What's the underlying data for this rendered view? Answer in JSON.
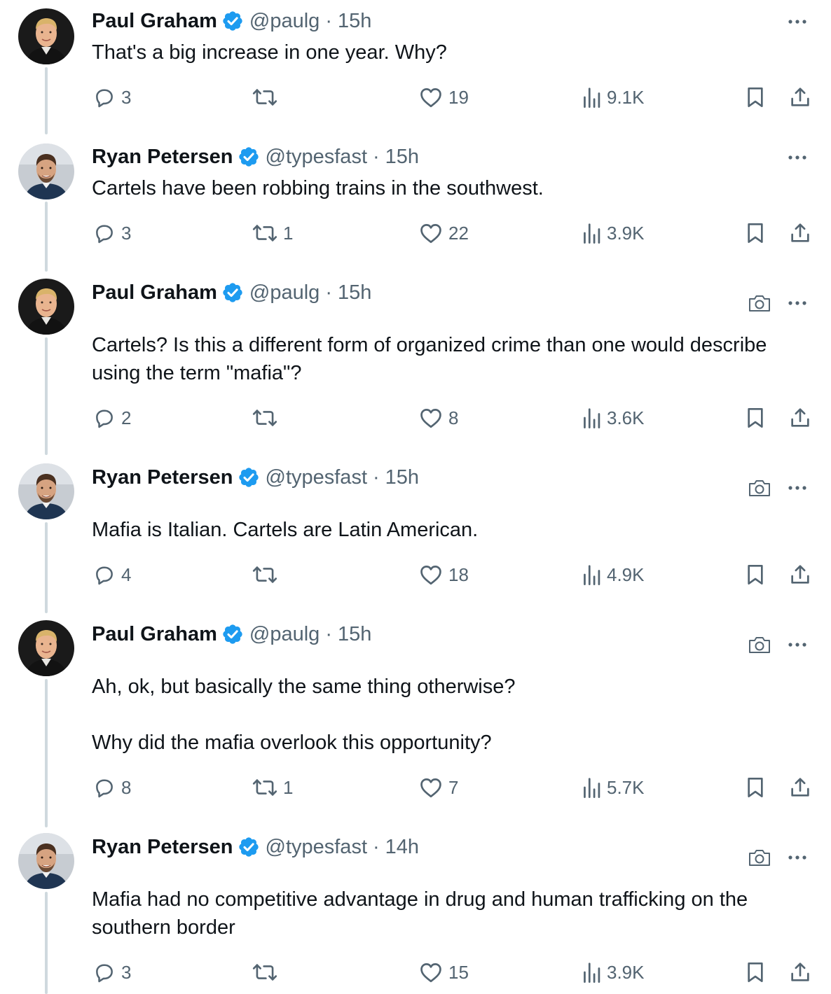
{
  "tweets": [
    {
      "name": "Paul Graham",
      "handle": "@paulg",
      "separator": "·",
      "time": "15h",
      "author": "pg",
      "show_camera": false,
      "text": "That's a big increase in one year. Why?",
      "replies": "3",
      "reposts": "",
      "likes": "19",
      "views": "9.1K"
    },
    {
      "name": "Ryan Petersen",
      "handle": "@typesfast",
      "separator": "·",
      "time": "15h",
      "author": "rp",
      "show_camera": false,
      "text": "Cartels have been robbing trains in the southwest.",
      "replies": "3",
      "reposts": "1",
      "likes": "22",
      "views": "3.9K"
    },
    {
      "name": "Paul Graham",
      "handle": "@paulg",
      "separator": "·",
      "time": "15h",
      "author": "pg",
      "show_camera": true,
      "text": "Cartels? Is this a different form of organized crime than one would describe using the term \"mafia\"?",
      "replies": "2",
      "reposts": "",
      "likes": "8",
      "views": "3.6K"
    },
    {
      "name": "Ryan Petersen",
      "handle": "@typesfast",
      "separator": "·",
      "time": "15h",
      "author": "rp",
      "show_camera": true,
      "text": "Mafia is Italian. Cartels are Latin American.",
      "replies": "4",
      "reposts": "",
      "likes": "18",
      "views": "4.9K"
    },
    {
      "name": "Paul Graham",
      "handle": "@paulg",
      "separator": "·",
      "time": "15h",
      "author": "pg",
      "show_camera": true,
      "text": "Ah, ok, but basically the same thing otherwise?\n\nWhy did the mafia overlook this opportunity?",
      "replies": "8",
      "reposts": "1",
      "likes": "7",
      "views": "5.7K"
    },
    {
      "name": "Ryan Petersen",
      "handle": "@typesfast",
      "separator": "·",
      "time": "14h",
      "author": "rp",
      "show_camera": true,
      "text": "Mafia had no competitive advantage in drug and human trafficking on the southern border",
      "replies": "3",
      "reposts": "",
      "likes": "15",
      "views": "3.9K"
    }
  ],
  "icons": {
    "reply": "reply-icon",
    "repost": "repost-icon",
    "like": "like-icon",
    "views": "views-icon",
    "bookmark": "bookmark-icon",
    "share": "share-icon",
    "verified": "verified-badge-icon",
    "more": "more-icon",
    "camera": "camera-icon"
  },
  "colors": {
    "verified": "#1d9bf0",
    "text": "#0f1419",
    "secondary": "#536471",
    "thread_line": "#cfd9de"
  }
}
